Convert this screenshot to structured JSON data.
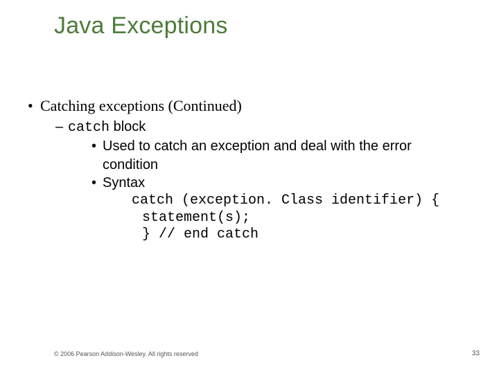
{
  "title": "Java Exceptions",
  "bullets": {
    "l1": "Catching exceptions (Continued)",
    "l2_code": "catch",
    "l2_rest": " block",
    "l3a": "Used to catch an exception and deal with the error",
    "l3a_cont": "condition",
    "l3b": "Syntax",
    "code1": "catch (exception. Class identifier) {",
    "code2": "statement(s);",
    "code3": "} // end catch"
  },
  "footer": {
    "copyright": "© 2006 Pearson Addison-Wesley. All rights reserved",
    "page": "33"
  }
}
